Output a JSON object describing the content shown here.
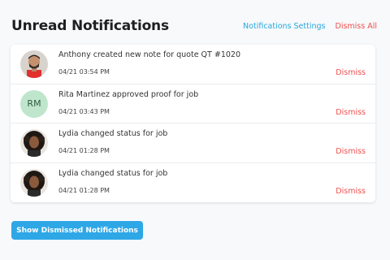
{
  "header": {
    "title": "Unread Notifications",
    "settings_label": "Notifications Settings",
    "dismiss_all_label": "Dismiss All"
  },
  "notifications": [
    {
      "avatar": "photo-man",
      "message": "Anthony created new note for quote QT #1020",
      "time": "04/21 03:54 PM",
      "dismiss_label": "Dismiss"
    },
    {
      "avatar": "initials",
      "initials": "RM",
      "message": "Rita Martinez approved proof for job",
      "time": "04/21 03:43 PM",
      "dismiss_label": "Dismiss"
    },
    {
      "avatar": "photo-woman",
      "message": "Lydia changed status for job",
      "time": "04/21 01:28 PM",
      "dismiss_label": "Dismiss"
    },
    {
      "avatar": "photo-woman",
      "message": "Lydia changed status for job",
      "time": "04/21 01:28 PM",
      "dismiss_label": "Dismiss"
    }
  ],
  "footer": {
    "show_dismissed_label": "Show Dismissed Notifications"
  },
  "colors": {
    "accent": "#2ea7e6",
    "danger": "#f04e4e",
    "initials_bg": "#bfe6cd"
  }
}
